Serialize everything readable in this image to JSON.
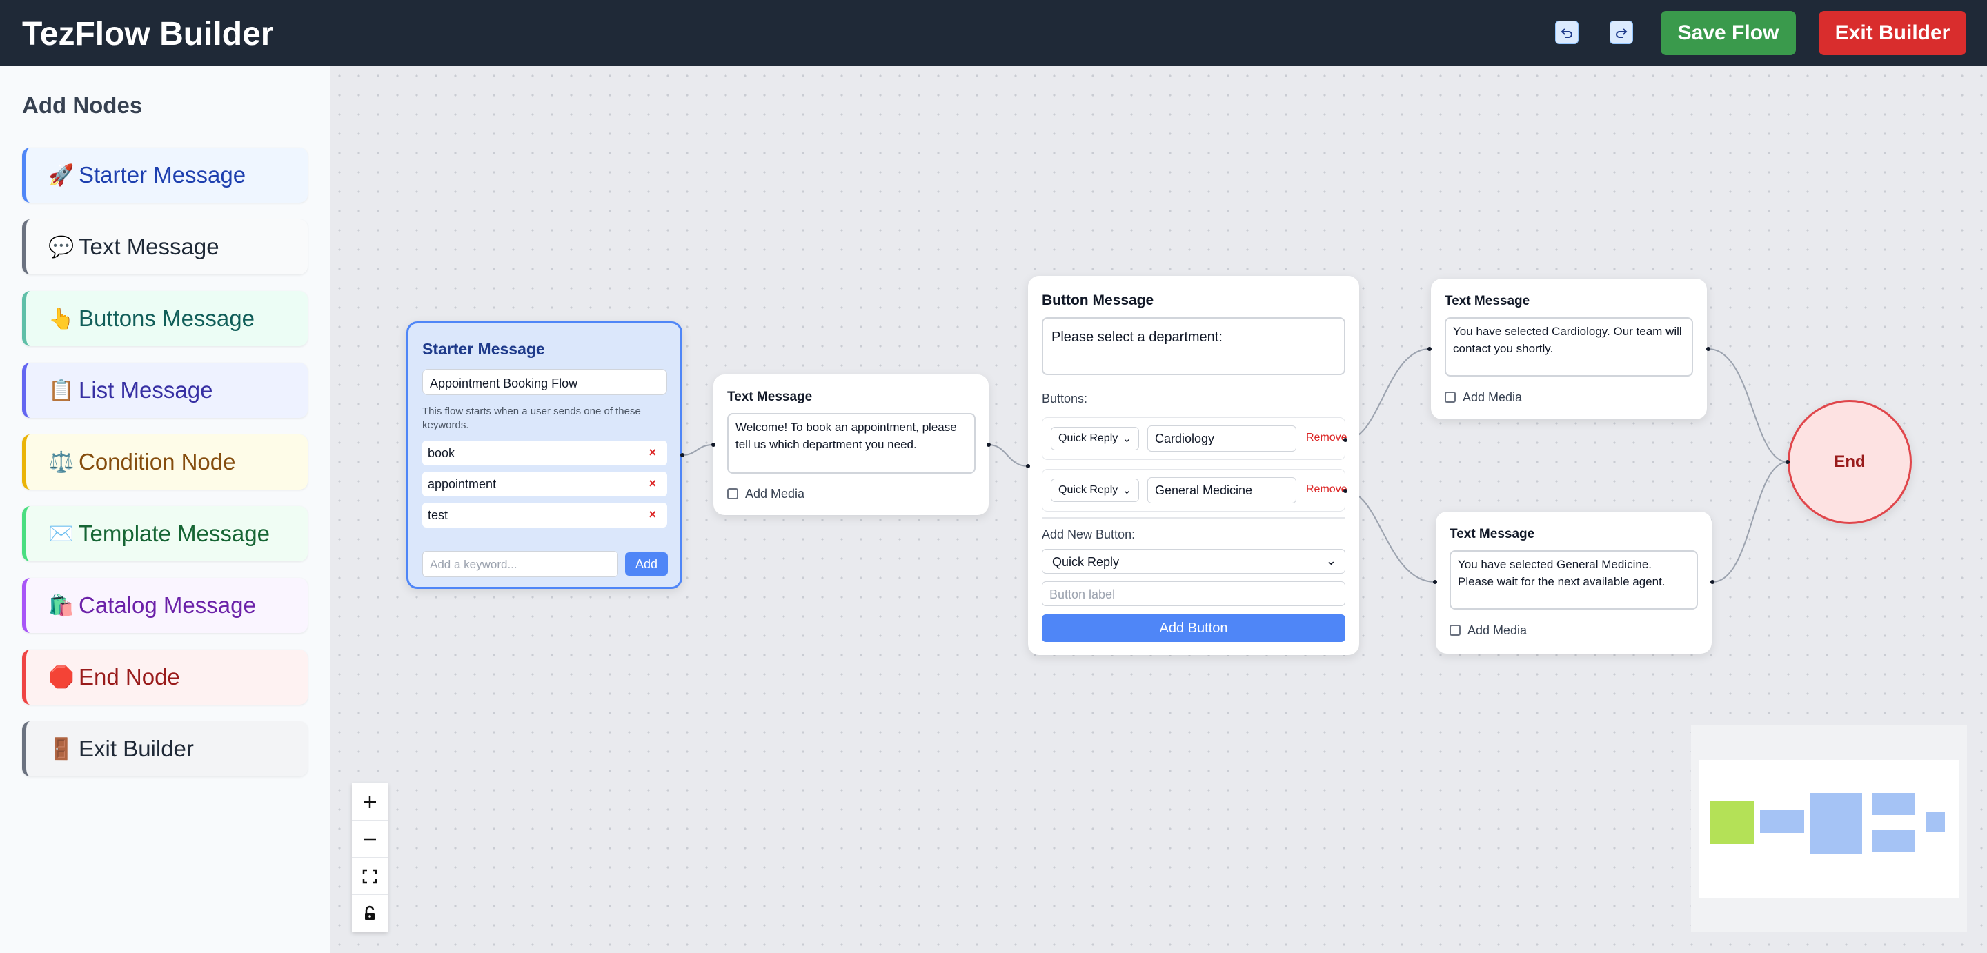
{
  "header": {
    "title": "TezFlow Builder",
    "save_label": "Save Flow",
    "exit_label": "Exit Builder"
  },
  "sidebar": {
    "title": "Add Nodes",
    "items": [
      {
        "icon": "🚀",
        "label": "Starter Message",
        "color": "#1e40af",
        "bg": "#eff6ff",
        "border": "#4f86f7"
      },
      {
        "icon": "💬",
        "label": "Text Message",
        "color": "#1f2937",
        "bg": "#f9fafb",
        "border": "#6b7280"
      },
      {
        "icon": "👆",
        "label": "Buttons Message",
        "color": "#115e59",
        "bg": "#ecfdf5",
        "border": "#5fbfa8"
      },
      {
        "icon": "📋",
        "label": "List Message",
        "color": "#3730a3",
        "bg": "#eef2ff",
        "border": "#6366f1"
      },
      {
        "icon": "⚖️",
        "label": "Condition Node",
        "color": "#854d0e",
        "bg": "#fefce8",
        "border": "#eab308"
      },
      {
        "icon": "✉️",
        "label": "Template Message",
        "color": "#166534",
        "bg": "#f0fdf4",
        "border": "#4ade80"
      },
      {
        "icon": "🛍️",
        "label": "Catalog Message",
        "color": "#6b21a8",
        "bg": "#faf5ff",
        "border": "#a855f7"
      },
      {
        "icon": "🛑",
        "label": "End Node",
        "color": "#991b1b",
        "bg": "#fef2f2",
        "border": "#ef4444"
      },
      {
        "icon": "🚪",
        "label": "Exit Builder",
        "color": "#1f2937",
        "bg": "#f3f4f6",
        "border": "#6b7280"
      }
    ]
  },
  "starter_node": {
    "title": "Starter Message",
    "flow_name": "Appointment Booking Flow",
    "description": "This flow starts when a user sends one of these keywords.",
    "keywords": [
      "book",
      "appointment",
      "test"
    ],
    "remove_glyph": "×",
    "keyword_placeholder": "Add a keyword...",
    "add_label": "Add"
  },
  "text_node_1": {
    "title": "Text Message",
    "text": "Welcome! To book an appointment, please tell us which department you need.",
    "media_label": "Add Media"
  },
  "button_node": {
    "title": "Button Message",
    "text": "Please select a department:",
    "buttons_label": "Buttons:",
    "buttons": [
      {
        "type": "Quick Reply",
        "label": "Cardiology",
        "remove": "Remove"
      },
      {
        "type": "Quick Reply",
        "label": "General Medicine",
        "remove": "Remove"
      }
    ],
    "add_new_label": "Add New Button:",
    "new_type": "Quick Reply",
    "label_placeholder": "Button label",
    "add_button_label": "Add Button"
  },
  "text_node_2": {
    "title": "Text Message",
    "text": "You have selected Cardiology. Our team will contact you shortly.",
    "media_label": "Add Media"
  },
  "text_node_3": {
    "title": "Text Message",
    "text": "You have selected General Medicine. Please wait for the next available agent.",
    "media_label": "Add Media"
  },
  "end_node": {
    "label": "End"
  },
  "controls": {
    "zoom_in": "+",
    "zoom_out": "—"
  }
}
